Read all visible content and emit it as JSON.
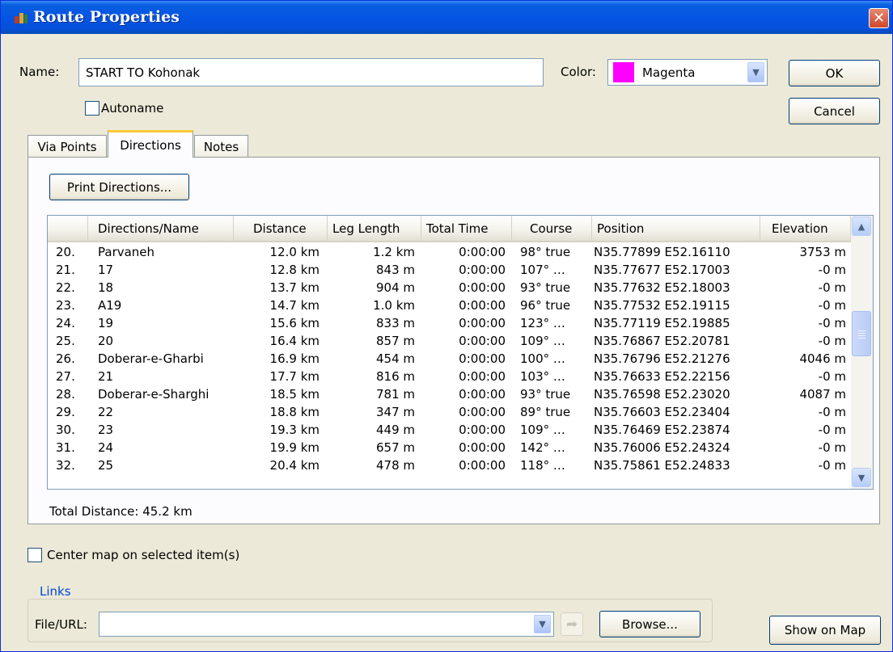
{
  "window": {
    "title": "Route Properties",
    "close_glyph": "✕"
  },
  "name_field": {
    "label": "Name:",
    "value": "START TO Kohonak"
  },
  "autoname": {
    "label": "Autoname",
    "checked": false
  },
  "color": {
    "label": "Color:",
    "value": "Magenta",
    "swatch": "#ff00ff"
  },
  "buttons": {
    "ok": "OK",
    "cancel": "Cancel",
    "print": "Print Directions...",
    "browse": "Browse...",
    "show_on_map": "Show on Map"
  },
  "tabs": [
    {
      "label": "Via Points",
      "active": false
    },
    {
      "label": "Directions",
      "active": true
    },
    {
      "label": "Notes",
      "active": false
    }
  ],
  "table": {
    "columns": [
      "",
      "Directions/Name",
      "Distance",
      "Leg Length",
      "Total Time",
      "Course",
      "Position",
      "Elevation"
    ],
    "rows": [
      [
        "20.",
        "Parvaneh",
        "12.0 km",
        "1.2 km",
        "0:00:00",
        "98° true",
        "N35.77899 E52.16110",
        "3753 m"
      ],
      [
        "21.",
        "17",
        "12.8 km",
        "843 m",
        "0:00:00",
        "107° …",
        "N35.77677 E52.17003",
        "-0 m"
      ],
      [
        "22.",
        "18",
        "13.7 km",
        "904 m",
        "0:00:00",
        "93° true",
        "N35.77632 E52.18003",
        "-0 m"
      ],
      [
        "23.",
        "A19",
        "14.7 km",
        "1.0 km",
        "0:00:00",
        "96° true",
        "N35.77532 E52.19115",
        "-0 m"
      ],
      [
        "24.",
        "19",
        "15.6 km",
        "833 m",
        "0:00:00",
        "123° …",
        "N35.77119 E52.19885",
        "-0 m"
      ],
      [
        "25.",
        "20",
        "16.4 km",
        "857 m",
        "0:00:00",
        "109° …",
        "N35.76867 E52.20781",
        "-0 m"
      ],
      [
        "26.",
        "Doberar-e-Gharbi",
        "16.9 km",
        "454 m",
        "0:00:00",
        "100° …",
        "N35.76796 E52.21276",
        "4046 m"
      ],
      [
        "27.",
        "21",
        "17.7 km",
        "816 m",
        "0:00:00",
        "103° …",
        "N35.76633 E52.22156",
        "-0 m"
      ],
      [
        "28.",
        "Doberar-e-Sharghi",
        "18.5 km",
        "781 m",
        "0:00:00",
        "93° true",
        "N35.76598 E52.23020",
        "4087 m"
      ],
      [
        "29.",
        "22",
        "18.8 km",
        "347 m",
        "0:00:00",
        "89° true",
        "N35.76603 E52.23404",
        "-0 m"
      ],
      [
        "30.",
        "23",
        "19.3 km",
        "449 m",
        "0:00:00",
        "109° …",
        "N35.76469 E52.23874",
        "-0 m"
      ],
      [
        "31.",
        "24",
        "19.9 km",
        "657 m",
        "0:00:00",
        "142° …",
        "N35.76006 E52.24324",
        "-0 m"
      ],
      [
        "32.",
        "25",
        "20.4 km",
        "478 m",
        "0:00:00",
        "118° …",
        "N35.75861 E52.24833",
        "-0 m"
      ]
    ]
  },
  "total_distance": "Total Distance: 45.2 km",
  "center_map": {
    "label": "Center map on selected item(s)",
    "checked": false
  },
  "links": {
    "title": "Links",
    "file_label": "File/URL:",
    "value": ""
  },
  "icons": {
    "app": "route-flag-icon",
    "close": "close-icon",
    "dropdown": "chevron-down-icon",
    "go": "arrow-go-icon",
    "scroll_up": "scroll-up-icon",
    "scroll_down": "scroll-down-icon"
  }
}
